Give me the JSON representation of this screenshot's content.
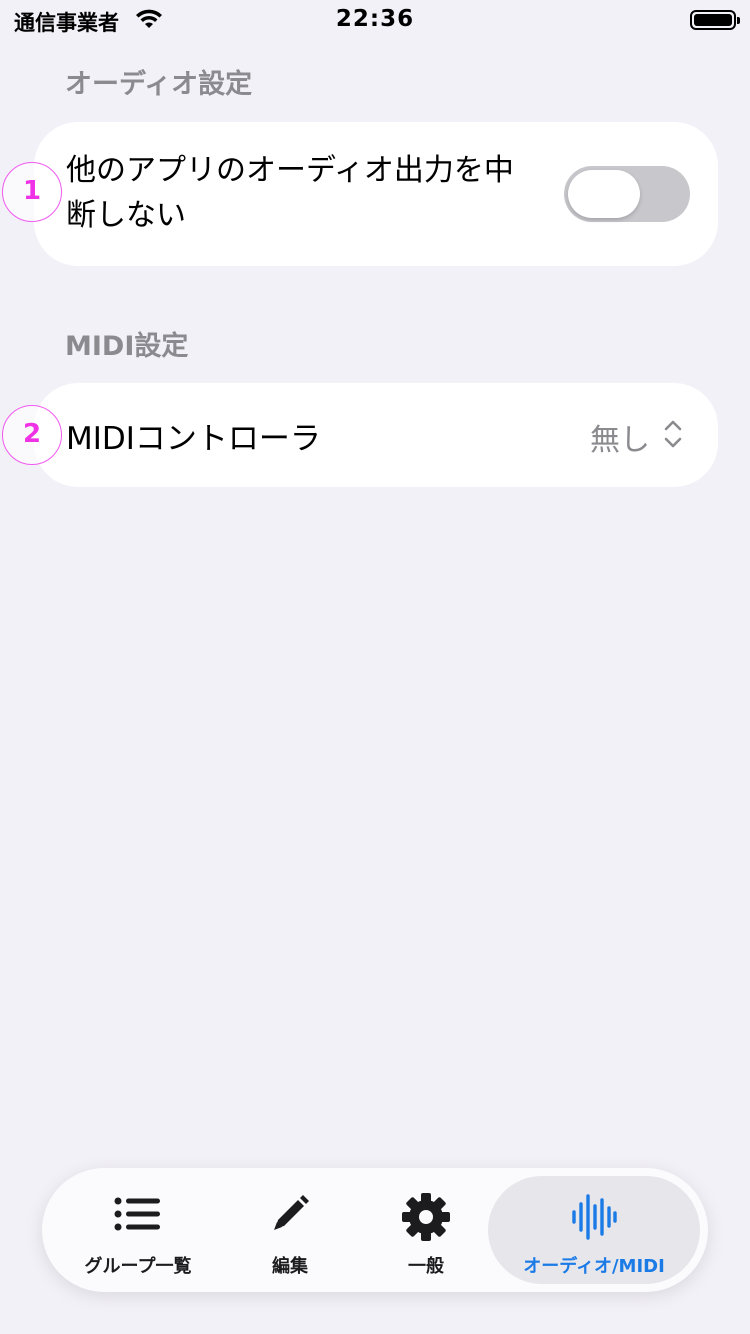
{
  "status_bar": {
    "carrier": "通信事業者",
    "time": "22:36"
  },
  "audio_section": {
    "header": "オーディオ設定",
    "toggle_label": "他のアプリのオーディオ出力を中断しない",
    "toggle_on": false
  },
  "midi_section": {
    "header": "MIDI設定",
    "controller_label": "MIDIコントローラ",
    "controller_value": "無し"
  },
  "badges": [
    "1",
    "2"
  ],
  "tabs": [
    {
      "label": "グループ一覧",
      "icon": "list-icon",
      "active": false
    },
    {
      "label": "編集",
      "icon": "pencil-icon",
      "active": false
    },
    {
      "label": "一般",
      "icon": "gear-icon",
      "active": false
    },
    {
      "label": "オーディオ/MIDI",
      "icon": "waveform-icon",
      "active": true
    }
  ],
  "colors": {
    "accent": "#1a7ae6",
    "background": "#f2f1f7",
    "badge": "#f032e6",
    "toggle_off": "#c7c7cc"
  }
}
